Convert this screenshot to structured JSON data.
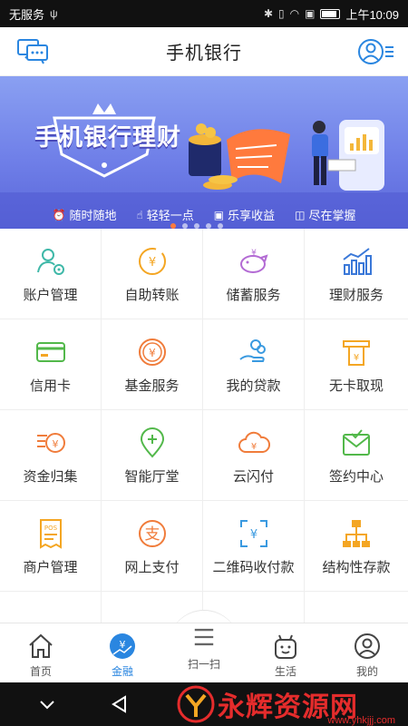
{
  "status_bar": {
    "carrier": "无服务",
    "usb_icon": "usb-icon",
    "time": "上午10:09"
  },
  "header": {
    "title": "手机银行",
    "left_icon": "message-icon",
    "right_icon": "profile-menu-icon"
  },
  "banner": {
    "title": "手机银行理财",
    "tags": [
      {
        "icon": "clock-icon",
        "label": "随时随地"
      },
      {
        "icon": "tap-icon",
        "label": "轻轻一点"
      },
      {
        "icon": "wallet-icon",
        "label": "乐享收益"
      },
      {
        "icon": "briefcase-icon",
        "label": "尽在掌握"
      }
    ],
    "active_slide": 1,
    "slide_count": 5
  },
  "grid": [
    {
      "label": "账户管理",
      "icon": "user-settings-icon"
    },
    {
      "label": "自助转账",
      "icon": "yen-transfer-icon"
    },
    {
      "label": "储蓄服务",
      "icon": "piggy-bank-icon"
    },
    {
      "label": "理财服务",
      "icon": "chart-growth-icon"
    },
    {
      "label": "信用卡",
      "icon": "credit-card-icon"
    },
    {
      "label": "基金服务",
      "icon": "yen-coin-icon"
    },
    {
      "label": "我的贷款",
      "icon": "hand-coins-icon"
    },
    {
      "label": "无卡取现",
      "icon": "cash-withdraw-icon"
    },
    {
      "label": "资金归集",
      "icon": "coin-stack-icon"
    },
    {
      "label": "智能厅堂",
      "icon": "location-pin-icon"
    },
    {
      "label": "云闪付",
      "icon": "cloud-yen-icon"
    },
    {
      "label": "签约中心",
      "icon": "signed-envelope-icon"
    },
    {
      "label": "商户管理",
      "icon": "pos-receipt-icon"
    },
    {
      "label": "网上支付",
      "icon": "alipay-icon"
    },
    {
      "label": "二维码收付款",
      "icon": "qr-yen-icon"
    },
    {
      "label": "结构性存款",
      "icon": "structure-icon"
    }
  ],
  "tabbar": [
    {
      "label": "首页",
      "icon": "home-icon",
      "active": false
    },
    {
      "label": "金融",
      "icon": "finance-icon",
      "active": true
    },
    {
      "label": "扫一扫",
      "icon": "scan-icon",
      "active": false
    },
    {
      "label": "生活",
      "icon": "life-icon",
      "active": false
    },
    {
      "label": "我的",
      "icon": "user-icon",
      "active": false
    }
  ],
  "watermark": {
    "text": "永辉资源网",
    "url": "www.yhkjjj.com"
  },
  "colors": {
    "accent": "#2a86e0",
    "banner": "#6f7fe8",
    "watermark": "#e52c2c"
  }
}
